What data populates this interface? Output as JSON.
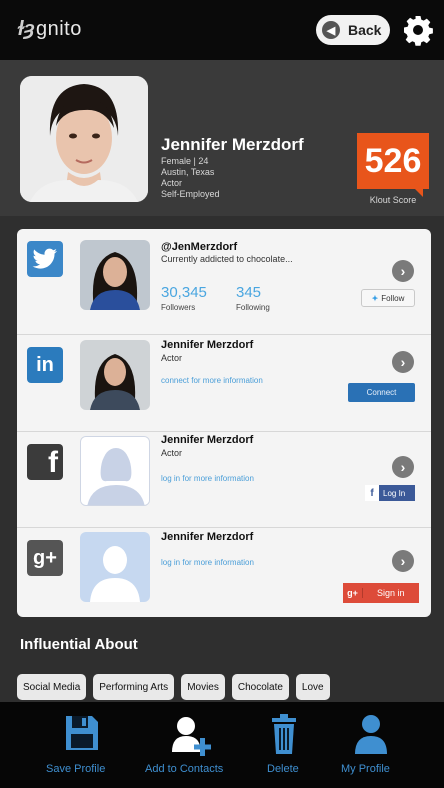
{
  "header": {
    "logo_text": "gnito",
    "back_label": "Back"
  },
  "profile": {
    "name": "Jennifer Merzdorf",
    "details": [
      "Female | 24",
      "Austin, Texas",
      "Actor",
      "Self-Employed"
    ],
    "klout_score": "526",
    "klout_label": "Klout Score"
  },
  "networks": {
    "twitter": {
      "handle": "@JenMerzdorf",
      "status": "Currently addicted to chocolate...",
      "followers": "30,345",
      "followers_label": "Followers",
      "following": "345",
      "following_label": "Following",
      "button": "Follow"
    },
    "linkedin": {
      "name": "Jennifer Merzdorf",
      "title": "Actor",
      "link": "connect for more information",
      "button": "Connect"
    },
    "facebook": {
      "name": "Jennifer Merzdorf",
      "title": "Actor",
      "link": "log in for more information",
      "button": "Log In"
    },
    "googleplus": {
      "name": "Jennifer Merzdorf",
      "link": "log in for more information",
      "button": "Sign in"
    }
  },
  "influential": {
    "title": "Influential About",
    "tags": [
      "Social Media",
      "Performing Arts",
      "Movies",
      "Chocolate",
      "Love"
    ]
  },
  "bottom_bar": {
    "items": [
      {
        "label": "Save Profile",
        "icon": "floppy-disk-icon"
      },
      {
        "label": "Add to Contacts",
        "icon": "add-contact-icon"
      },
      {
        "label": "Delete",
        "icon": "trash-icon"
      },
      {
        "label": "My Profile",
        "icon": "person-icon"
      }
    ]
  },
  "colors": {
    "accent_blue": "#3f8fd0",
    "klout_orange": "#e8551b",
    "twitter": "#3aa0e6",
    "linkedin": "#2a71b5",
    "facebook": "#3b5998",
    "googleplus": "#dd4b39"
  }
}
